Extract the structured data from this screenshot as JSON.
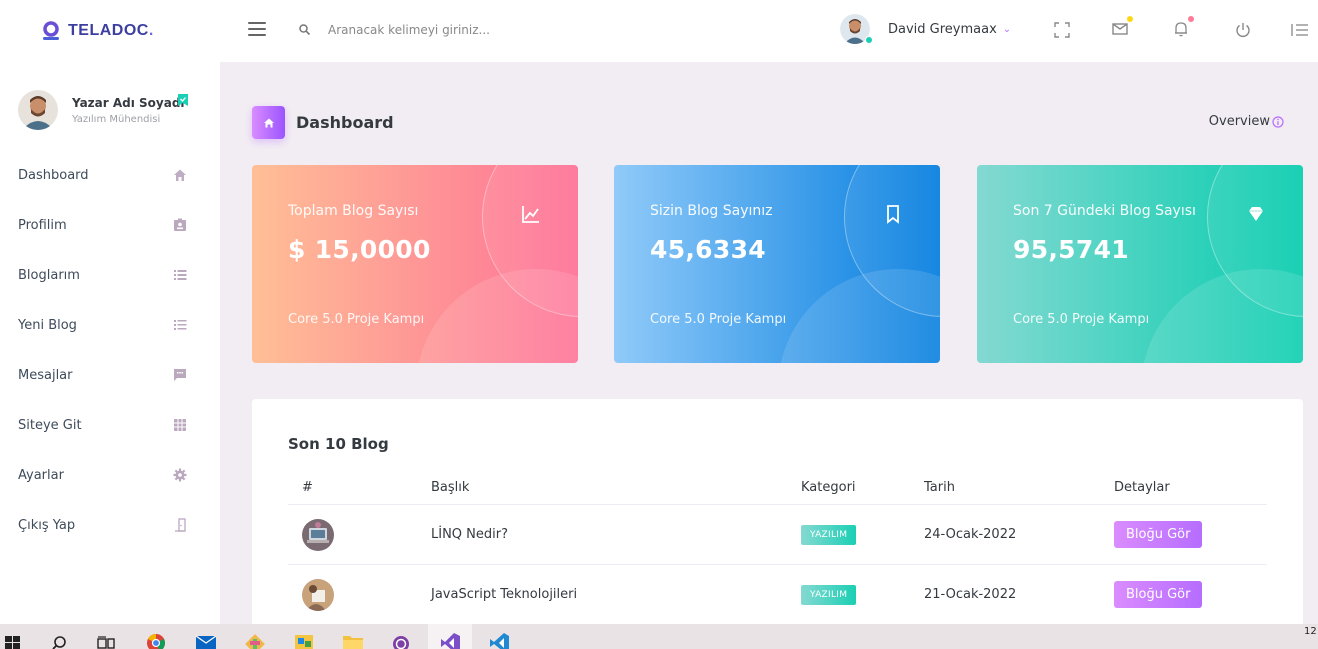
{
  "brand": {
    "name": "TELADOC",
    "dot": "."
  },
  "search": {
    "placeholder": "Aranacak kelimeyi giriniz..."
  },
  "nav": {
    "user_name": "David Greymaax",
    "icons": [
      "fullscreen-icon",
      "mail-icon",
      "bell-icon",
      "power-icon",
      "list-icon"
    ],
    "mail_dot_color": "#fed713",
    "bell_dot_color": "#fe7c96"
  },
  "sidebar": {
    "profile": {
      "name": "Yazar Adı Soyadı",
      "role": "Yazılım Mühendisi"
    },
    "items": [
      {
        "label": "Dashboard",
        "icon": "home-icon"
      },
      {
        "label": "Profilim",
        "icon": "profile-card-icon"
      },
      {
        "label": "Bloglarım",
        "icon": "list-icon"
      },
      {
        "label": "Yeni Blog",
        "icon": "format-list-icon"
      },
      {
        "label": "Mesajlar",
        "icon": "message-icon"
      },
      {
        "label": "Siteye Git",
        "icon": "grid-icon"
      },
      {
        "label": "Ayarlar",
        "icon": "gear-icon"
      },
      {
        "label": "Çıkış Yap",
        "icon": "logout-icon"
      }
    ]
  },
  "page": {
    "title": "Dashboard",
    "overview": "Overview"
  },
  "cards": [
    {
      "title": "Toplam Blog Sayısı",
      "value": "$ 15,0000",
      "sub": "Core 5.0 Proje Kampı",
      "icon": "chart-line-icon"
    },
    {
      "title": "Sizin Blog Sayınız",
      "value": "45,6334",
      "sub": "Core 5.0 Proje Kampı",
      "icon": "bookmark-icon"
    },
    {
      "title": "Son 7 Gündeki Blog Sayısı",
      "value": "95,5741",
      "sub": "Core 5.0 Proje Kampı",
      "icon": "diamond-icon"
    }
  ],
  "table": {
    "title": "Son 10 Blog",
    "headers": {
      "num": "#",
      "title": "Başlık",
      "category": "Kategori",
      "date": "Tarih",
      "details": "Detaylar"
    },
    "rows": [
      {
        "title": "LİNQ Nedir?",
        "category": "YAZILIM",
        "date": "24-Ocak-2022",
        "action": "Bloğu Gör"
      },
      {
        "title": "JavaScript Teknolojileri",
        "category": "YAZILIM",
        "date": "21-Ocak-2022",
        "action": "Bloğu Gör"
      }
    ]
  },
  "taskbar": {
    "apps": [
      "windows-start-icon",
      "search-icon",
      "task-view-icon",
      "chrome-icon",
      "mail-icon",
      "git-icon",
      "paint-icon",
      "file-explorer-icon",
      "tor-icon",
      "visual-studio-icon",
      "vscode-icon"
    ],
    "time": "12"
  },
  "colors": {
    "primary": "#b66dff",
    "danger": "#fe7096",
    "info": "#047edf",
    "success": "#1bcfb4"
  }
}
